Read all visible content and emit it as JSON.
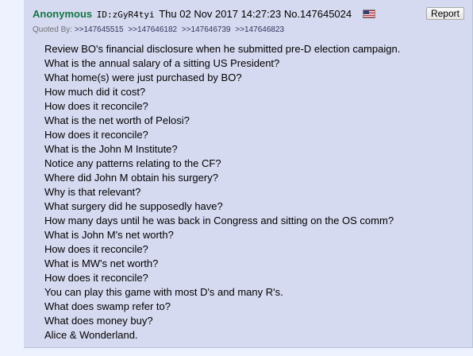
{
  "post": {
    "name": "Anonymous",
    "poster_id": "ID:zGyR4tyi",
    "datetime": "Thu 02 Nov 2017 14:27:23",
    "post_number": "No.147645024",
    "flag": "us-flag-icon",
    "report_label": "Report",
    "quoted_by": {
      "label": "Quoted By:",
      "links": [
        ">>147645515",
        ">>147646182",
        ">>147646739",
        ">>147646823"
      ]
    },
    "message_lines": [
      "Review BO's financial disclosure when he submitted pre-D election campaign.",
      "What is the annual salary of a sitting US President?",
      "What home(s) were just purchased by BO?",
      "How much did it cost?",
      "How does it reconcile?",
      "What is the net worth of Pelosi?",
      "How does it reconcile?",
      "What is the John M Institute?",
      "Notice any patterns relating to the CF?",
      "Where did John M obtain his surgery?",
      "Why is that relevant?",
      "What surgery did he supposedly have?",
      "How many days until he was back in Congress and sitting on the OS comm?",
      "What is John M's net worth?",
      "How does it reconcile?",
      "What is MW's net worth?",
      "How does it reconcile?",
      "You can play this game with most D's and many R's.",
      "What does swamp refer to?",
      "What does money buy?",
      "Alice & Wonderland."
    ]
  },
  "colors": {
    "page_background": "#eef2ff",
    "post_background": "#d6daf0",
    "name": "#117743",
    "quote_link": "#34345c",
    "quoted_by_label": "#707070"
  }
}
